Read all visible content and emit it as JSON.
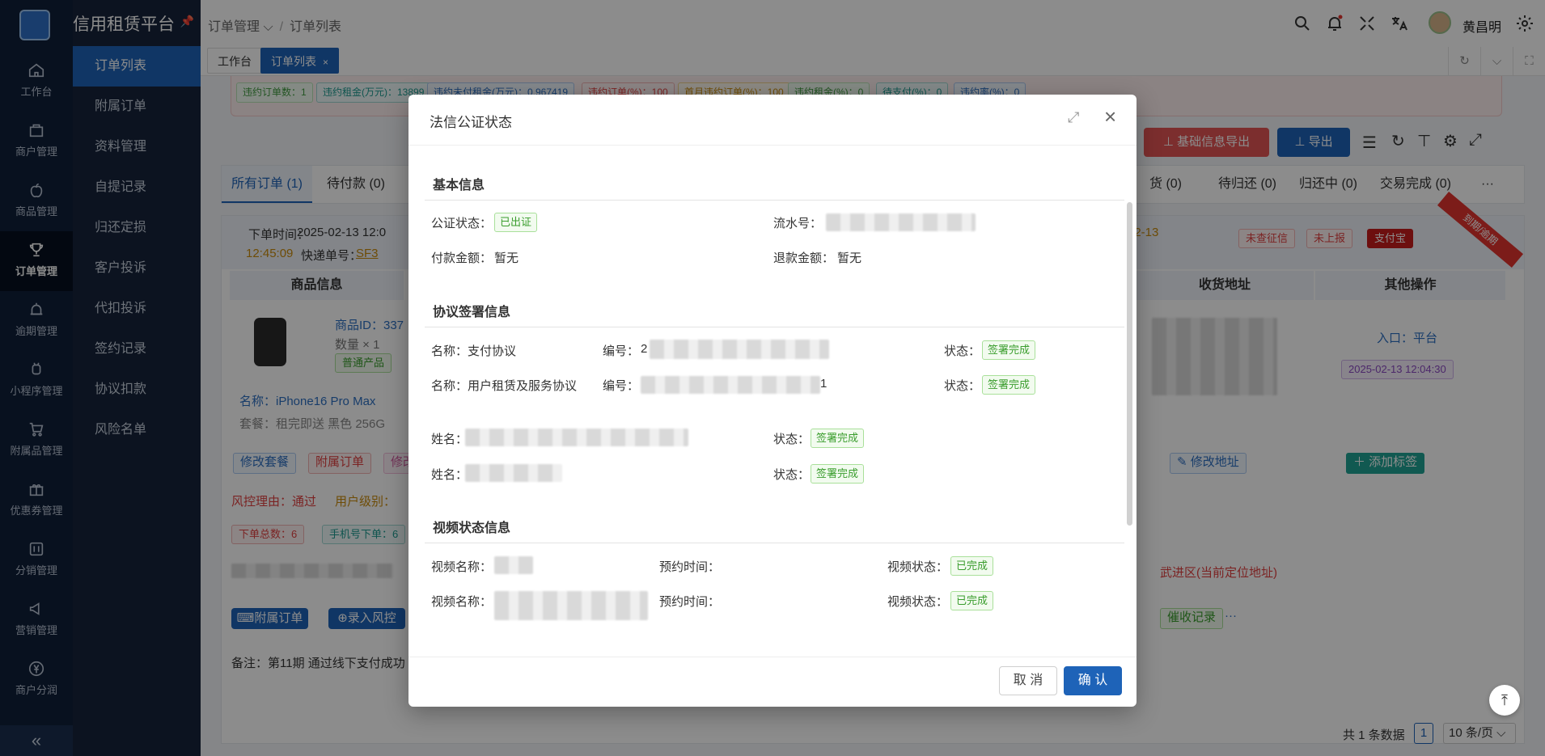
{
  "app": {
    "title": "信用租赁平台"
  },
  "rail": [
    {
      "label": "工作台",
      "icon": "home-icon"
    },
    {
      "label": "商户管理",
      "icon": "shop-icon"
    },
    {
      "label": "商品管理",
      "icon": "apple-icon"
    },
    {
      "label": "订单管理",
      "icon": "trophy-icon"
    },
    {
      "label": "逾期管理",
      "icon": "alarm-icon"
    },
    {
      "label": "小程序管理",
      "icon": "android-icon"
    },
    {
      "label": "附属品管理",
      "icon": "cart-icon"
    },
    {
      "label": "优惠券管理",
      "icon": "gift-icon"
    },
    {
      "label": "分销管理",
      "icon": "sliders-icon"
    },
    {
      "label": "营销管理",
      "icon": "megaphone-icon"
    },
    {
      "label": "商户分润",
      "icon": "yen-icon"
    }
  ],
  "rail_collapse": "«",
  "submenu": [
    "订单列表",
    "附属订单",
    "资料管理",
    "自提记录",
    "归还定损",
    "客户投诉",
    "代扣投诉",
    "签约记录",
    "协议扣款",
    "风险名单"
  ],
  "header": {
    "crumb1": "订单管理",
    "crumb2": "订单列表",
    "user": "黄昌明"
  },
  "tabs": [
    {
      "label": "工作台"
    },
    {
      "label": "订单列表",
      "close": "×"
    }
  ],
  "stats": [
    "违约订单数：1",
    "违约租金(万元)：13899",
    "违约未付租金(万元)：0.967419",
    "违约订单(%)：100",
    "首月违约订单(%)：100",
    "违约租金(%)：0",
    "待支付(%)：0",
    "违约率(%)：0"
  ],
  "actions": {
    "export_basic": "⊥ 基础信息导出",
    "export": "⊥ 导出"
  },
  "order_tabs": [
    {
      "label": "所有订单 (1)"
    },
    {
      "label": "待付款 (0)"
    },
    {
      "label": "货 (0)"
    },
    {
      "label": "待归还 (0)"
    },
    {
      "label": "归还中 (0)"
    },
    {
      "label": "交易完成 (0)"
    },
    {
      "label": "···"
    }
  ],
  "order": {
    "time_label": "下单时间：",
    "time": "2025-02-13 12:0",
    "time2": "12:45:09",
    "express_label": "快递单号：",
    "express": "SF3",
    "date_right": "02-13",
    "tags_right": [
      "未查征信",
      "未上报",
      "支付宝"
    ],
    "ribbon": "到期/逾期",
    "col_goods": "商品信息",
    "col_addr": "收货地址",
    "col_other": "其他操作",
    "goods_id": "商品ID：337",
    "qty": "数量 × 1",
    "goods_tag": "普通产品",
    "goods_name": "名称：iPhone16 Pro Max",
    "package": "套餐：租完即送 黑色 256G",
    "entry": "入口：平台",
    "entry_time": "2025-02-13 12:04:30",
    "btn_modify_pkg": "修改套餐",
    "btn_sub_order": "附属订单",
    "btn_modify": "修改",
    "btn_modify_addr": "✎ 修改地址",
    "btn_add_tag": "＋ 添加标签",
    "risk_reason": "风控理由：通过",
    "user_level": "用户级别：",
    "count_tags": [
      "下单总数：6",
      "手机号下单：6"
    ],
    "location": "武进区(当前定位地址)",
    "btn_attach": "⌨附属订单",
    "btn_risk": "⊕录入风控",
    "btn_collect": "催收记录",
    "more": "···",
    "remark": "备注：第11期 通过线下支付成功"
  },
  "pager": {
    "total": "共 1 条数据",
    "page": "1",
    "size": "10 条/页 ⌵"
  },
  "modal": {
    "title": "法信公证状态",
    "sec_basic": "基本信息",
    "notary_status_label": "公证状态：",
    "notary_status": "已出证",
    "serial_label": "流水号：",
    "pay_amount_label": "付款金额：",
    "pay_amount": "暂无",
    "refund_label": "退款金额：",
    "refund": "暂无",
    "sec_agreement": "协议签署信息",
    "agreements": [
      {
        "name": "名称：支付协议",
        "no_label": "编号：",
        "no_visible": "2",
        "status_label": "状态：",
        "status": "签署完成"
      },
      {
        "name": "名称：用户租赁及服务协议",
        "no_label": "编号：",
        "no_visible": "1",
        "status_label": "状态：",
        "status": "签署完成"
      }
    ],
    "signers": [
      {
        "name_label": "姓名：",
        "status_label": "状态：",
        "status": "签署完成"
      },
      {
        "name_label": "姓名：",
        "status_label": "状态：",
        "status": "签署完成"
      }
    ],
    "sec_video": "视频状态信息",
    "videos": [
      {
        "name_label": "视频名称：",
        "time_label": "预约时间：",
        "status_label": "视频状态：",
        "status": "已完成"
      },
      {
        "name_label": "视频名称：",
        "time_label": "预约时间：",
        "status_label": "视频状态：",
        "status": "已完成"
      }
    ],
    "cancel": "取 消",
    "confirm": "确 认"
  },
  "colors": {
    "primary": "#1e63b8",
    "danger": "#e2342f",
    "success": "#3a9d2d",
    "rail_bg": "#0f1f3a"
  }
}
